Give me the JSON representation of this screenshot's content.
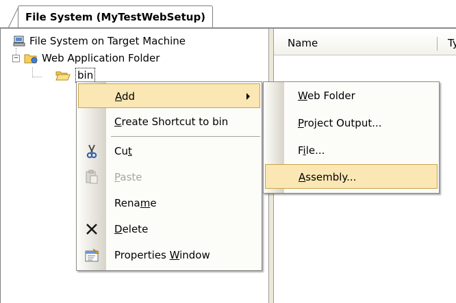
{
  "tab": {
    "title": "File System (MyTestWebSetup)"
  },
  "tree": {
    "root": {
      "label": "File System on Target Machine",
      "icon": "computer-icon"
    },
    "web_app_folder": {
      "label": "Web Application Folder",
      "icon": "web-folder-icon",
      "expander": "−"
    },
    "bin": {
      "label": "bin",
      "icon": "folder-open-icon"
    }
  },
  "list": {
    "columns": [
      "Name",
      "Type"
    ]
  },
  "context_menu": {
    "items": [
      {
        "label": "Add",
        "has_submenu": true,
        "highlighted": true
      },
      {
        "label": "Create Shortcut to bin"
      },
      {
        "label": "Cut",
        "icon": "scissors-icon"
      },
      {
        "label": "Paste",
        "icon": "clipboard-icon",
        "disabled": true
      },
      {
        "label": "Rename"
      },
      {
        "label": "Delete",
        "icon": "delete-x-icon"
      },
      {
        "label": "Properties Window",
        "icon": "properties-icon"
      }
    ]
  },
  "submenu": {
    "items": [
      {
        "label": "Web Folder"
      },
      {
        "label": "Project Output..."
      },
      {
        "label": "File..."
      },
      {
        "label": "Assembly...",
        "highlighted": true
      }
    ]
  },
  "colors": {
    "highlight": "#fae7b4",
    "highlight_border": "#c9a24a",
    "gutter": "#d7d4c9"
  }
}
